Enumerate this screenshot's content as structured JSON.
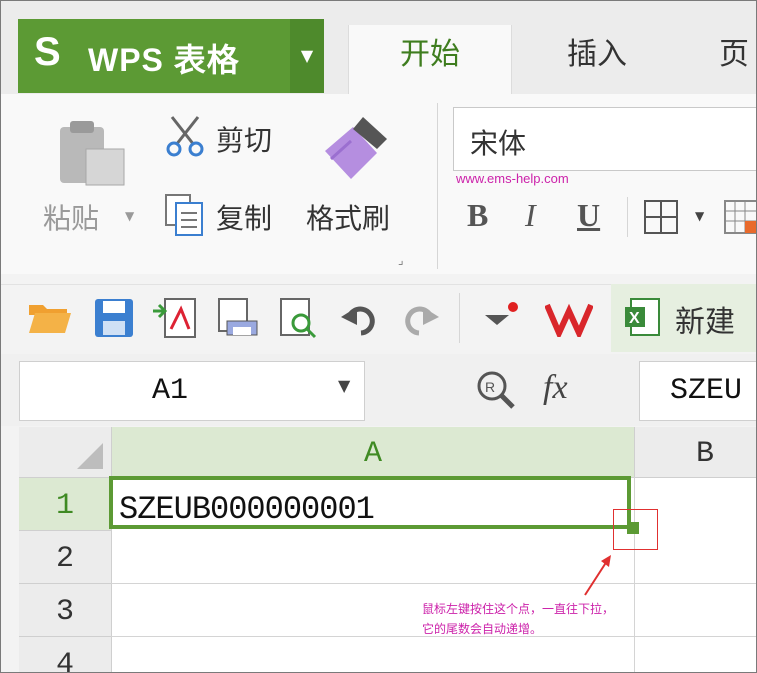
{
  "app": {
    "logo_glyph": "S",
    "title": "WPS 表格",
    "brand_color": "#5c9a34"
  },
  "tabs": [
    {
      "label": "开始",
      "active": true
    },
    {
      "label": "插入",
      "active": false
    },
    {
      "label": "页",
      "active": false
    }
  ],
  "ribbon": {
    "paste_label": "粘贴",
    "cut_label": "剪切",
    "copy_label": "复制",
    "format_painter_label": "格式刷",
    "font_name": "宋体",
    "bold": "B",
    "italic": "I",
    "underline": "U"
  },
  "watermark": "www.ems-help.com",
  "quickbar": {
    "new_label": "新建",
    "icons": [
      "open-folder-icon",
      "save-icon",
      "export-pdf-icon",
      "print-preview-icon",
      "print-icon",
      "undo-icon",
      "redo-icon",
      "customize-icon",
      "wps-logo-icon",
      "new-sheet-icon"
    ]
  },
  "formula_bar": {
    "cell_ref": "A1",
    "fx_label": "fx",
    "content": "SZEU"
  },
  "sheet": {
    "columns": [
      "A",
      "B"
    ],
    "rows": [
      "1",
      "2",
      "3",
      "4"
    ],
    "cell_a1": "SZEUB000000001",
    "selection_color": "#5c9a34"
  },
  "annotation": {
    "line1": "鼠标左键按住这个点，一直往下拉，",
    "line2": "它的尾数会自动递增。",
    "color": "#cc22aa"
  }
}
